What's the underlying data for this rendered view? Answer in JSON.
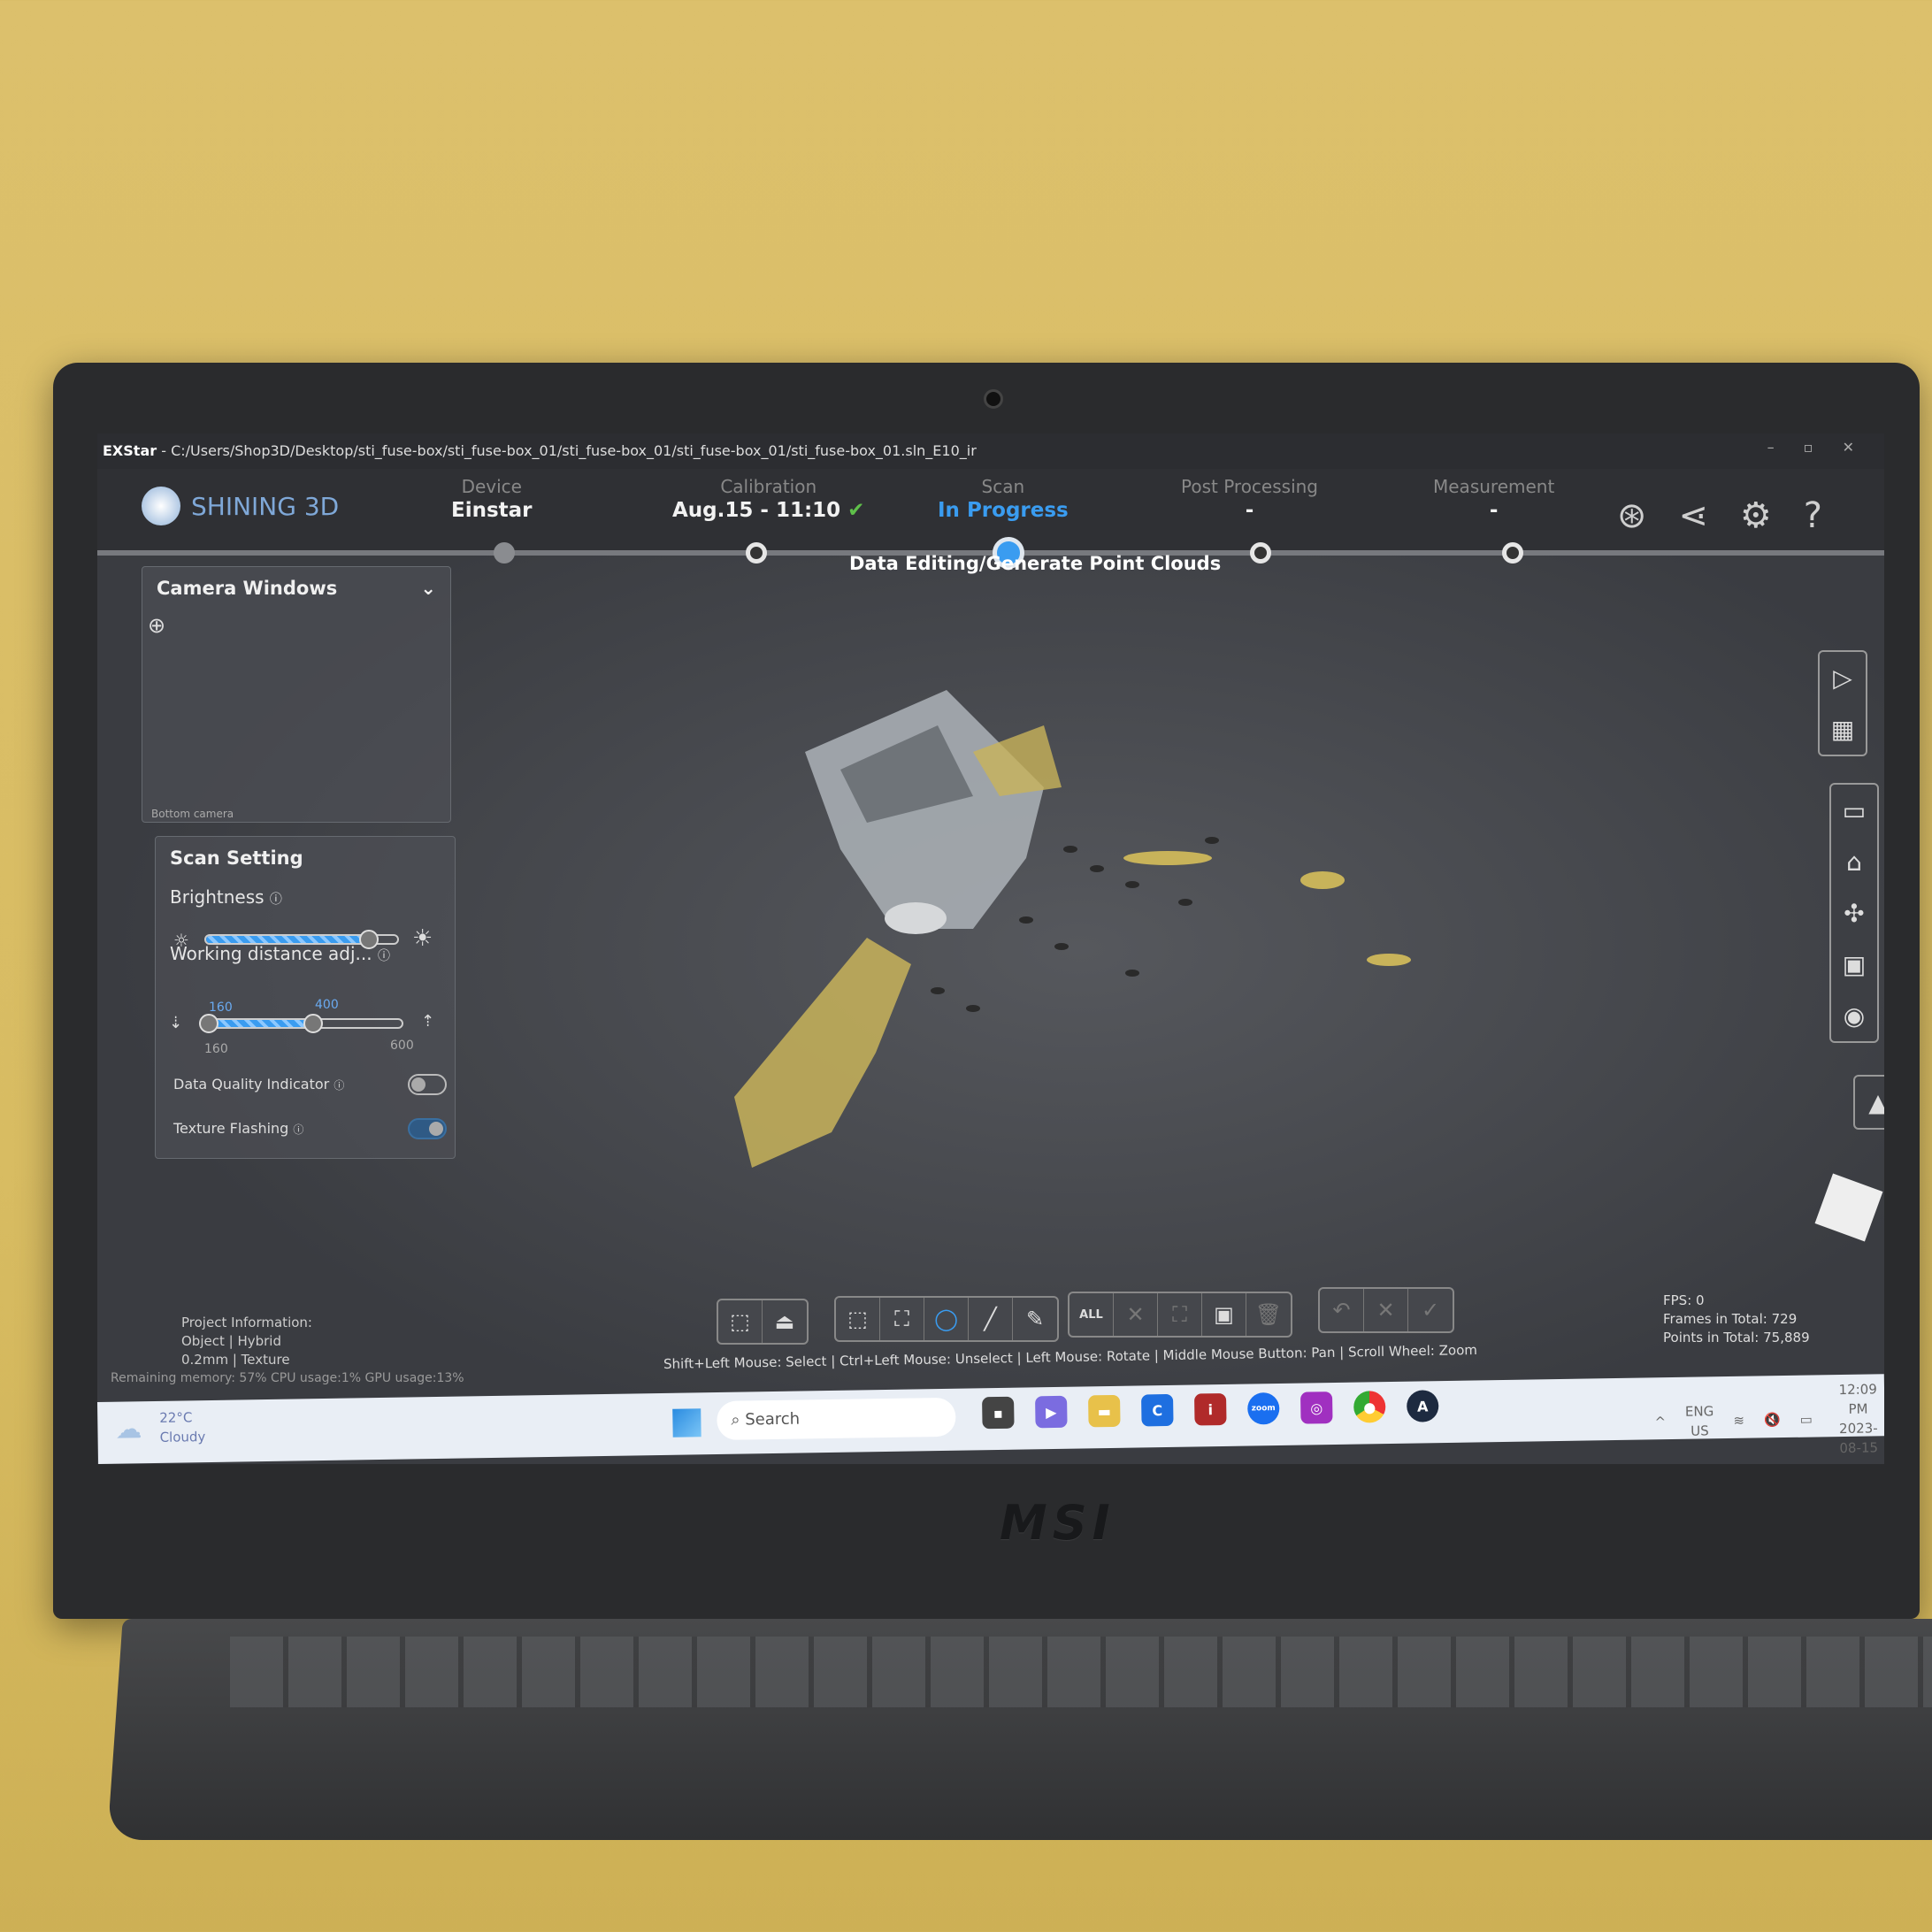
{
  "window": {
    "app": "EXStar",
    "separator": "-",
    "path": "C:/Users/Shop3D/Desktop/sti_fuse-box/sti_fuse-box_01/sti_fuse-box_01/sti_fuse-box_01/sti_fuse-box_01.sln_E10_ir",
    "controls": "– ▫ ✕"
  },
  "logo": "SHINING 3D",
  "steps": [
    {
      "label": "Device",
      "value": "Einstar"
    },
    {
      "label": "Calibration",
      "value": "Aug.15 - 11:10"
    },
    {
      "label": "Scan",
      "value": "In Progress"
    },
    {
      "label": "Post Processing",
      "value": "-"
    },
    {
      "label": "Measurement",
      "value": "-"
    }
  ],
  "substep": "Data Editing/Generate Point Clouds",
  "header_icons": [
    "scanner-icon",
    "share-icon",
    "gear-icon",
    "help-icon"
  ],
  "camera": {
    "title": "Camera Windows",
    "view_label": "Bottom camera"
  },
  "scan_setting": {
    "title": "Scan Setting",
    "brightness": {
      "label": "Brightness",
      "level_percent": 85
    },
    "working_distance": {
      "label": "Working distance adj...",
      "min": 160,
      "max": 600,
      "low": 160,
      "high": 400
    },
    "data_quality": {
      "label": "Data Quality Indicator",
      "on": false
    },
    "texture_flashing": {
      "label": "Texture Flashing",
      "on": true
    }
  },
  "project": {
    "title": "Project Information:",
    "line1": "Object | Hybrid",
    "line2": "0.2mm | Texture"
  },
  "usage": "Remaining memory: 57% CPU usage:1%  GPU usage:13%",
  "hint": "Shift+Left Mouse: Select | Ctrl+Left Mouse: Unselect | Left Mouse: Rotate | Middle Mouse Button: Pan | Scroll Wheel: Zoom",
  "stats": {
    "fps": "FPS: 0",
    "frames": "Frames in Total: 729",
    "points": "Points in Total: 75,889"
  },
  "toolbar": {
    "all_label": "ALL"
  },
  "taskbar": {
    "temp": "22°C",
    "weather": "Cloudy",
    "search": "Search",
    "lang1": "ENG",
    "lang2": "US",
    "time": "12:09 PM",
    "date": "2023-08-15"
  },
  "device_brand": "MSI",
  "colors": {
    "accent": "#3a9cf0",
    "check": "#5fc04a",
    "background": "#dcc06c"
  }
}
